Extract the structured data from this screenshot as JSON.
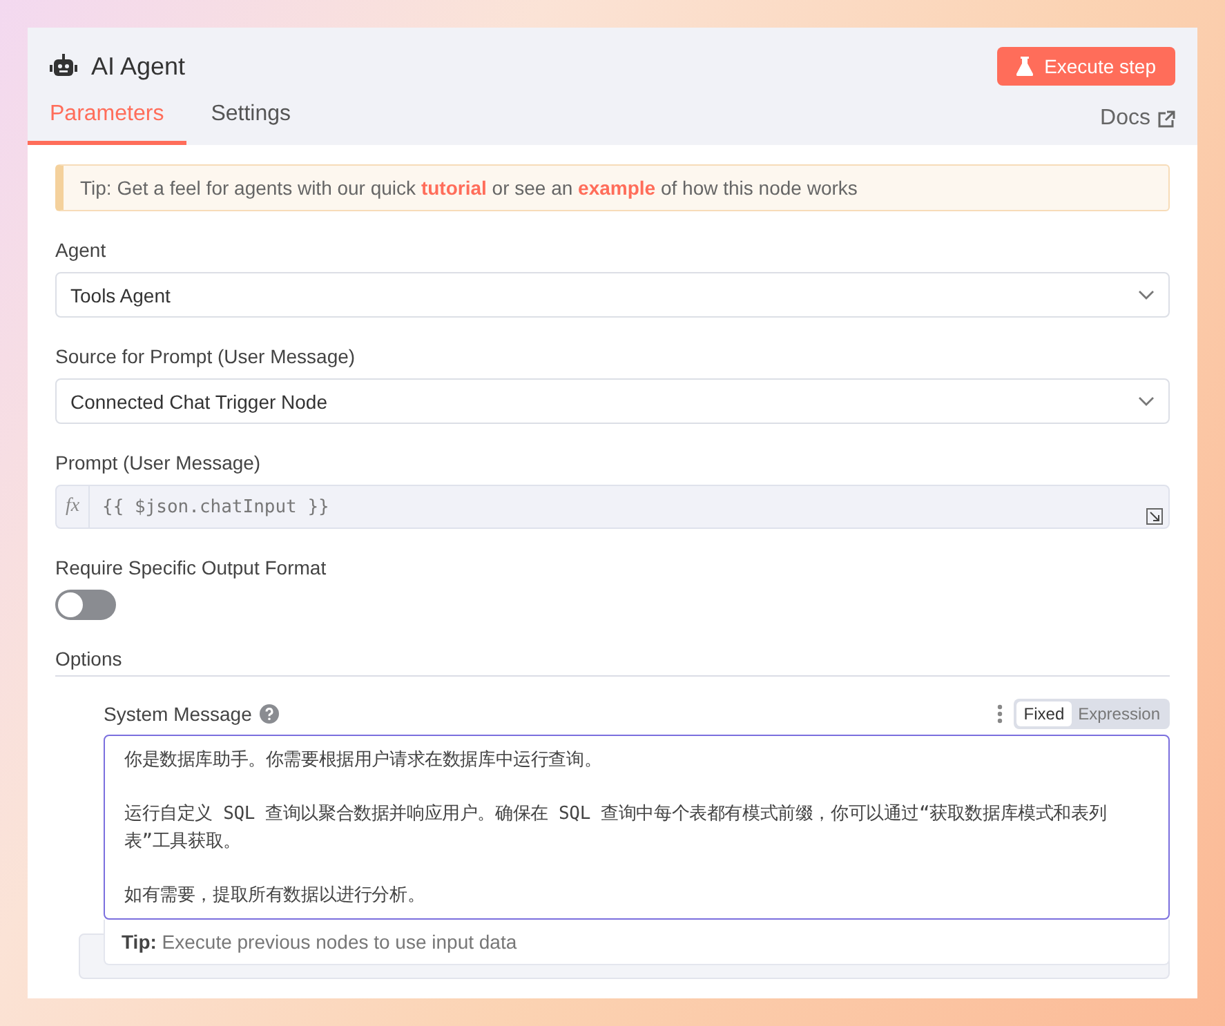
{
  "header": {
    "title": "AI Agent",
    "execute_button": "Execute step"
  },
  "tabs": [
    {
      "label": "Parameters",
      "selected": true
    },
    {
      "label": "Settings",
      "selected": false
    }
  ],
  "docs_link": "Docs",
  "tip": "Tip: Get a feel for agents with our quick **tutorial** or see an **example** of how this node works",
  "fields": [
    {
      "kind": "select",
      "label": "Agent",
      "value": "Tools Agent"
    },
    {
      "kind": "select",
      "label": "Source for Prompt (User Message)",
      "value": "Connected Chat Trigger Node"
    },
    {
      "kind": "expression",
      "label": "Prompt (User Message)",
      "fx": "fx",
      "value": "{{ $json.chatInput }}"
    },
    {
      "kind": "toggle",
      "label": "Require Specific Output Format",
      "on": false
    }
  ],
  "options": {
    "label": "Options",
    "system_message": {
      "label": "System Message",
      "modes": [
        {
          "label": "Fixed",
          "selected": true
        },
        {
          "label": "Expression",
          "selected": false
        }
      ],
      "paragraphs": [
        "你是数据库助手。你需要根据用户请求在数据库中运行查询。",
        "运行自定义 SQL 查询以聚合数据并响应用户。确保在 SQL 查询中每个表都有模式前缀，你可以通过“获取数据库模式和表列表”工具获取。",
        "如有需要，提取所有数据以进行分析。"
      ],
      "hint_label": "Tip:",
      "hint": "Execute previous nodes to use input data"
    }
  }
}
